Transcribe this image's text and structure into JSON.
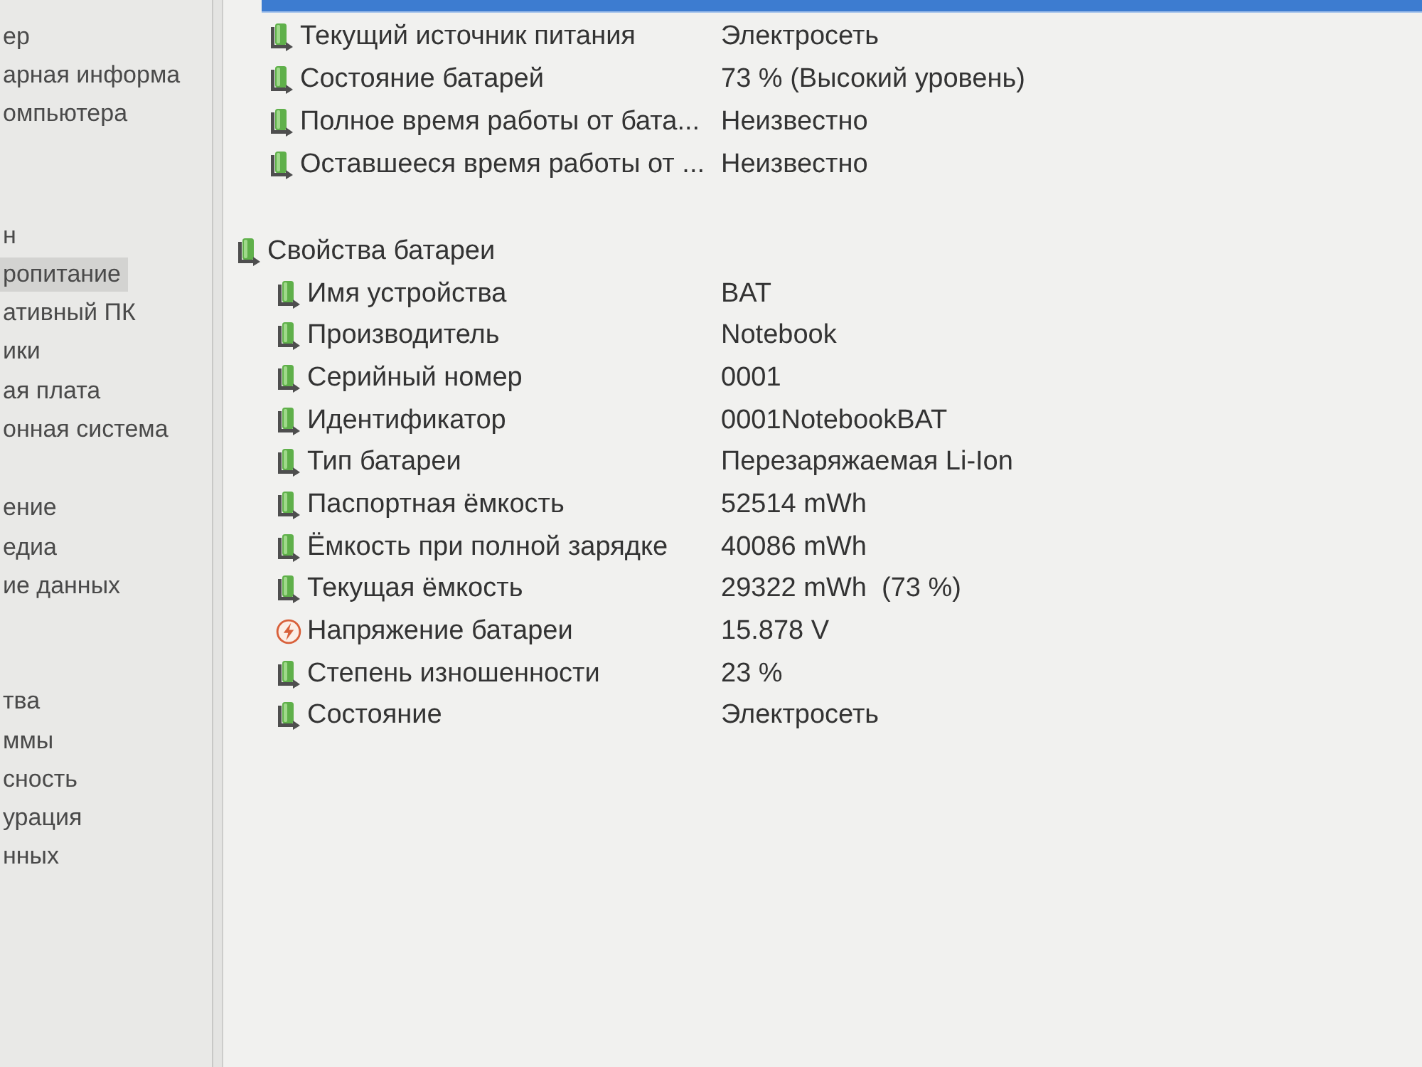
{
  "sidebar": {
    "groups": [
      {
        "items": [
          {
            "label": "ер",
            "selected": false
          },
          {
            "label": "арная информа",
            "selected": false
          },
          {
            "label": "омпьютера",
            "selected": false
          }
        ]
      },
      {
        "items": [
          {
            "label": "н",
            "selected": false
          },
          {
            "label": "ропитание",
            "selected": true
          },
          {
            "label": "ативный ПК",
            "selected": false
          },
          {
            "label": "ики",
            "selected": false
          },
          {
            "label": "ая плата",
            "selected": false
          },
          {
            "label": "онная система",
            "selected": false
          }
        ]
      },
      {
        "items": [
          {
            "label": "ение",
            "selected": false
          },
          {
            "label": "едиа",
            "selected": false
          },
          {
            "label": "ие данных",
            "selected": false
          }
        ]
      },
      {
        "items": [
          {
            "label": "тва",
            "selected": false
          },
          {
            "label": "ммы",
            "selected": false
          },
          {
            "label": "сность",
            "selected": false
          },
          {
            "label": "урация",
            "selected": false
          },
          {
            "label": "нных",
            "selected": false
          }
        ]
      }
    ]
  },
  "power_properties": {
    "items": [
      {
        "kind": "battery",
        "label": "Текущий источник питания",
        "value": "Электросеть"
      },
      {
        "kind": "battery",
        "label": "Состояние батарей",
        "value": "73 % (Высокий уровень)"
      },
      {
        "kind": "battery",
        "label": "Полное время работы от бата...",
        "value": "Неизвестно"
      },
      {
        "kind": "battery",
        "label": "Оставшееся время работы от ...",
        "value": "Неизвестно"
      }
    ]
  },
  "battery_properties": {
    "title": "Свойства батареи",
    "items": [
      {
        "kind": "battery",
        "label": "Имя устройства",
        "value": "BAT"
      },
      {
        "kind": "battery",
        "label": "Производитель",
        "value": "Notebook"
      },
      {
        "kind": "battery",
        "label": "Серийный номер",
        "value": "0001"
      },
      {
        "kind": "battery",
        "label": "Идентификатор",
        "value": "0001NotebookBAT"
      },
      {
        "kind": "battery",
        "label": "Тип батареи",
        "value": "Перезаряжаемая Li-Ion"
      },
      {
        "kind": "battery",
        "label": "Паспортная ёмкость",
        "value": "52514 mWh"
      },
      {
        "kind": "battery",
        "label": "Ёмкость при полной зарядке",
        "value": "40086 mWh"
      },
      {
        "kind": "battery",
        "label": "Текущая ёмкость",
        "value": "29322 mWh  (73 %)"
      },
      {
        "kind": "voltage",
        "label": "Напряжение батареи",
        "value": "15.878 V"
      },
      {
        "kind": "battery",
        "label": "Степень изношенности",
        "value": "23 %"
      },
      {
        "kind": "battery",
        "label": "Состояние",
        "value": "Электросеть"
      }
    ]
  }
}
